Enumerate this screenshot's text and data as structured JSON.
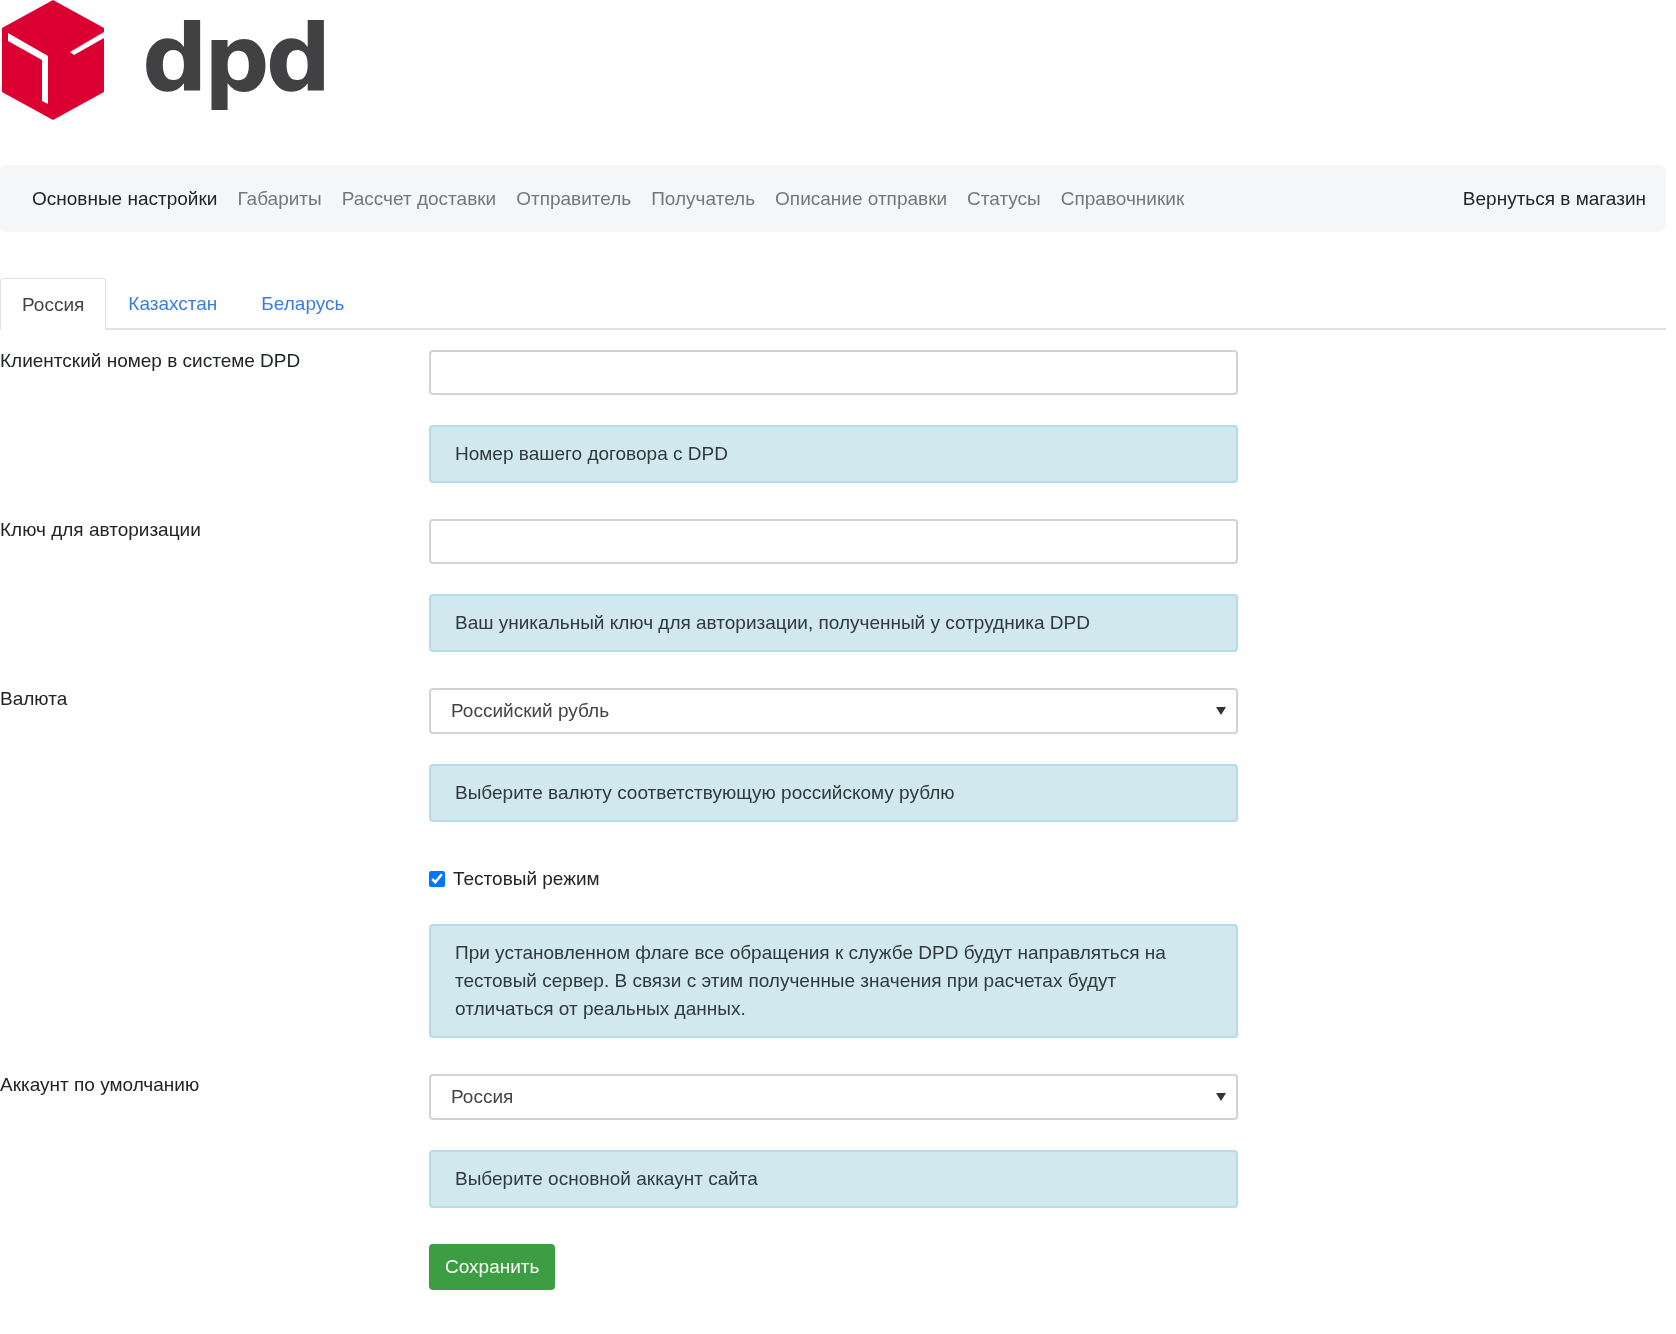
{
  "logo": {
    "wordmark": "dpd"
  },
  "nav": {
    "items": [
      {
        "label": "Основные настройки",
        "selected": true
      },
      {
        "label": "Габариты",
        "selected": false
      },
      {
        "label": "Рассчет доставки",
        "selected": false
      },
      {
        "label": "Отправитель",
        "selected": false
      },
      {
        "label": "Получатель",
        "selected": false
      },
      {
        "label": "Описание отправки",
        "selected": false
      },
      {
        "label": "Статусы",
        "selected": false
      },
      {
        "label": "Справочникик",
        "selected": false
      }
    ],
    "right_link": "Вернуться в магазин"
  },
  "tabs": [
    {
      "label": "Россия",
      "selected": true
    },
    {
      "label": "Казахстан",
      "selected": false
    },
    {
      "label": "Беларусь",
      "selected": false
    }
  ],
  "form": [
    {
      "kind": "text",
      "label": "Клиентский номер в системе DPD",
      "help": "Номер вашего договора с DPD"
    },
    {
      "kind": "text",
      "label": "Ключ для авторизации",
      "help": "Ваш уникальный ключ для авторизации, полученный у сотрудника DPD"
    },
    {
      "kind": "select",
      "label": "Валюта",
      "value": "Российский рубль",
      "help": "Выберите валюту соответствующую российскому рублю"
    },
    {
      "kind": "checkbox",
      "option": "Тестовый режим",
      "checked": true,
      "help": "При установленном флаге все обращения к службе DPD будут направляться на тестовый сервер. В связи с этим полученные значения при расчетах будут отличаться от реальных данных."
    },
    {
      "kind": "select",
      "label": "Аккаунт по умолчанию",
      "value": "Россия",
      "help": "Выберите основной аккаунт сайта"
    }
  ],
  "save_button": "Сохранить"
}
